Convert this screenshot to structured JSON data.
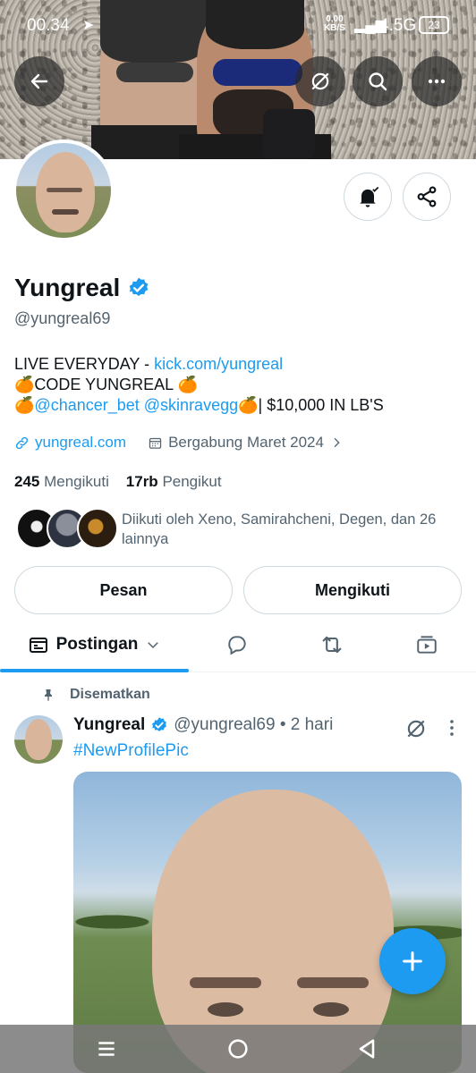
{
  "status_bar": {
    "time": "00.34",
    "net_speed_value": "0,00",
    "net_speed_unit": "KB/S",
    "network": "4.5G",
    "battery": "23"
  },
  "profile": {
    "name": "Yungreal",
    "handle": "@yungreal69",
    "bio": {
      "line1_prefix": "LIVE EVERYDAY - ",
      "line1_link": "kick.com/yungreal",
      "line2": "🍊CODE YUNGREAL 🍊",
      "line3_emoji": "🍊",
      "line3_link1": "@chancer_bet",
      "line3_link2": "@skinravegg",
      "line3_suffix": "🍊| $10,000 IN LB'S"
    },
    "website": "yungreal.com",
    "joined": "Bergabung Maret 2024",
    "following_count": "245",
    "following_label": "Mengikuti",
    "followers_count": "17rb",
    "followers_label": "Pengikut",
    "followed_by": "Diikuti oleh Xeno, Samirahcheni, Degen, dan 26 lainnya"
  },
  "actions": {
    "message": "Pesan",
    "following": "Mengikuti"
  },
  "tabs": {
    "posts": "Postingan"
  },
  "post": {
    "pinned_label": "Disematkan",
    "author": "Yungreal",
    "handle_time": "@yungreal69 • 2 hari",
    "text": "#NewProfilePic"
  },
  "colors": {
    "accent": "#1d9bf0",
    "text": "#0f1419",
    "muted": "#536471"
  }
}
